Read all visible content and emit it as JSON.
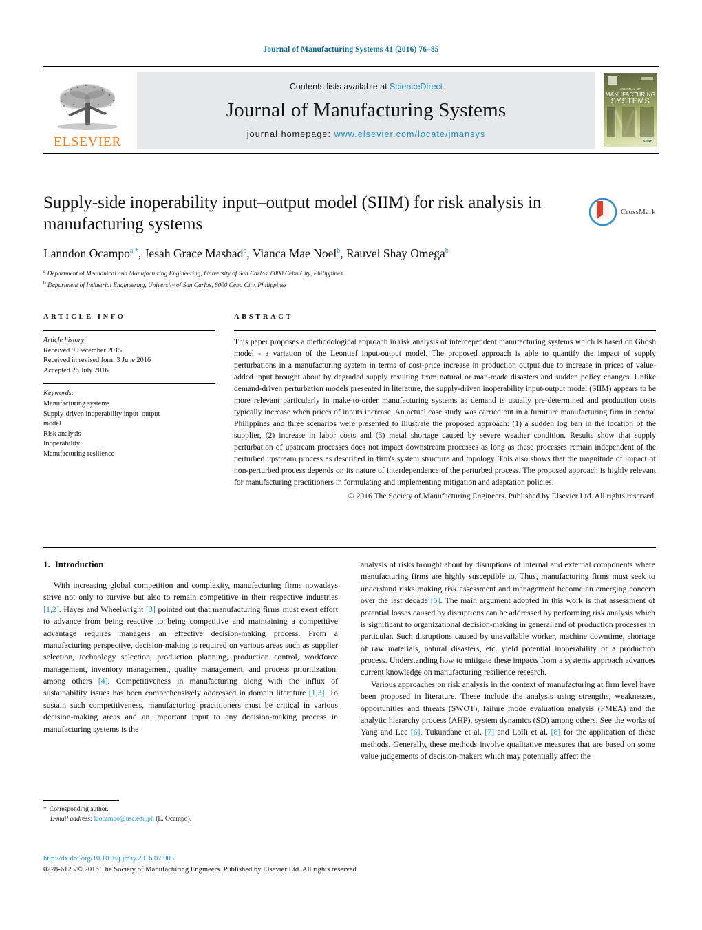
{
  "running_head": "Journal of Manufacturing Systems 41 (2016) 76–85",
  "masthead": {
    "publisher_name": "ELSEVIER",
    "contents_prefix": "Contents lists available at ",
    "contents_link": "ScienceDirect",
    "journal_title": "Journal of Manufacturing Systems",
    "homepage_prefix": "journal homepage: ",
    "homepage_url": "www.elsevier.com/locate/jmansys",
    "cover": {
      "line1": "JOURNAL OF",
      "line2": "MANUFACTURING",
      "line3": "SYSTEMS",
      "watermark": "M",
      "society_mark": "sme"
    }
  },
  "article": {
    "title": "Supply-side inoperability input–output model (SIIM) for risk analysis in manufacturing systems",
    "authors_html": "Lanndon Ocampo<sup>a,*</sup>, Jesah Grace Masbad<sup>b</sup>, Vianca Mae Noel<sup>b</sup>, Rauvel Shay Omega<sup>b</sup>",
    "affiliation_a": "Department of Mechanical and Manufacturing Engineering, University of San Carlos, 6000 Cebu City, Philippines",
    "affiliation_b": "Department of Industrial Engineering, University of San Carlos, 6000 Cebu City, Philippines",
    "crossmark_label": "CrossMark"
  },
  "article_info": {
    "heading": "ARTICLE INFO",
    "history_label": "Article history:",
    "history": [
      "Received 9 December 2015",
      "Received in revised form 3 June 2016",
      "Accepted 26 July 2016"
    ],
    "keywords_label": "Keywords:",
    "keywords": [
      "Manufacturing systems",
      "Supply-driven inoperability input–output",
      "model",
      "Risk analysis",
      "Inoperability",
      "Manufacturing resilience"
    ]
  },
  "abstract": {
    "heading": "ABSTRACT",
    "text": "This paper proposes a methodological approach in risk analysis of interdependent manufacturing systems which is based on Ghosh model - a variation of the Leontief input-output model. The proposed approach is able to quantify the impact of supply perturbations in a manufacturing system in terms of cost-price increase in production output due to increase in prices of value-added input brought about by degraded supply resulting from natural or man-made disasters and sudden policy changes. Unlike demand-driven perturbation models presented in literature, the supply-driven inoperability input-output model (SIIM) appears to be more relevant particularly in make-to-order manufacturing systems as demand is usually pre-determined and production costs typically increase when prices of inputs increase. An actual case study was carried out in a furniture manufacturing firm in central Philippines and three scenarios were presented to illustrate the proposed approach: (1) a sudden log ban in the location of the supplier, (2) increase in labor costs and (3) metal shortage caused by severe weather condition. Results show that supply perturbation of upstream processes does not impact downstream processes as long as these processes remain independent of the perturbed upstream process as described in firm's system structure and topology. This also shows that the magnitude of impact of non-perturbed process depends on its nature of interdependence of the perturbed process. The proposed approach is highly relevant for manufacturing practitioners in formulating and implementing mitigation and adaptation policies.",
    "copyright": "© 2016 The Society of Manufacturing Engineers. Published by Elsevier Ltd. All rights reserved."
  },
  "introduction": {
    "number": "1.",
    "heading": "Introduction",
    "left_paragraph_html": "With increasing global competition and complexity, manufacturing firms nowadays strive not only to survive but also to remain competitive in their respective industries <span class=\"ref\">[1,2]</span>. Hayes and Wheelwright <span class=\"ref\">[3]</span> pointed out that manufacturing firms must exert effort to advance from being reactive to being competitive and maintaining a competitive advantage requires managers an effective decision-making process. From a manufacturing perspective, decision-making is required on various areas such as supplier selection, technology selection, production planning, production control, workforce management, inventory management, quality management, and process prioritization, among others <span class=\"ref\">[4]</span>. Competitiveness in manufacturing along with the influx of sustainability issues has been comprehensively addressed in domain literature <span class=\"ref\">[1,3]</span>. To sustain such competitiveness, manufacturing practitioners must be critical in various decision-making areas and an important input to any decision-making process in manufacturing systems is the",
    "right_paragraph_1_html": "analysis of risks brought about by disruptions of internal and external components where manufacturing firms are highly susceptible to. Thus, manufacturing firms must seek to understand risks making risk assessment and management become an emerging concern over the last decade <span class=\"ref\">[5]</span>. The main argument adopted in this work is that assessment of potential losses caused by disruptions can be addressed by performing risk analysis which is significant to organizational decision-making in general and of production processes in particular. Such disruptions caused by unavailable worker, machine downtime, shortage of raw materials, natural disasters, etc. yield potential inoperability of a production process. Understanding how to mitigate these impacts from a systems approach advances current knowledge on manufacturing resilience research.",
    "right_paragraph_2_html": "Various approaches on risk analysis in the context of manufacturing at firm level have been proposed in literature. These include the analysis using strengths, weaknesses, opportunities and threats (SWOT), failure mode evaluation analysis (FMEA) and the analytic hierarchy process (AHP), system dynamics (SD) among others. See the works of Yang and Lee <span class=\"ref\">[6]</span>, Tukundane et al. <span class=\"ref\">[7]</span> and Lolli et al. <span class=\"ref\">[8]</span> for the application of these methods. Generally, these methods involve qualitative measures that are based on some value judgements of decision-makers which may potentially affect the"
  },
  "footnote": {
    "star": "*",
    "corresponding": "Corresponding author.",
    "email_label": "E-mail address:",
    "email": "laocampo@usc.edu.ph",
    "email_suffix": "(L. Ocampo)."
  },
  "footer": {
    "doi": "http://dx.doi.org/10.1016/j.jmsy.2016.07.005",
    "issn_line": "0278-6125/© 2016 The Society of Manufacturing Engineers. Published by Elsevier Ltd. All rights reserved."
  },
  "colors": {
    "link": "#1f8fc6",
    "running_head": "#0b6a96",
    "elsevier_orange": "#f07c20",
    "masthead_bg": "#e7e8ea"
  }
}
